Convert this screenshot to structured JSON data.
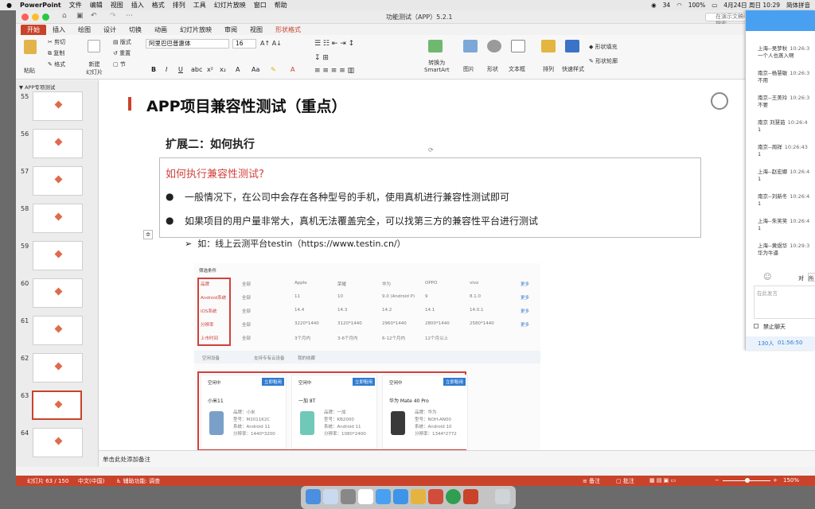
{
  "menubar": {
    "app": "PowerPoint",
    "items": [
      "文件",
      "编辑",
      "视图",
      "插入",
      "格式",
      "排列",
      "工具",
      "幻灯片放映",
      "窗口",
      "帮助"
    ],
    "battery": "100%",
    "date": "4月24日 周日 10:29",
    "ime": "简体拼音",
    "net": "34",
    "speed": "38.4 K/s\n5.6 K/s"
  },
  "window": {
    "title": "功能测试（APP）5.2.1",
    "search_placeholder": "在演示文稿中搜索"
  },
  "tabs": [
    "开始",
    "插入",
    "绘图",
    "设计",
    "切换",
    "动画",
    "幻灯片放映",
    "审阅",
    "视图",
    "形状格式"
  ],
  "ribbon": {
    "paste": "粘贴",
    "cut": "剪切",
    "copy": "复制",
    "format": "格式",
    "new_slide": "新建\n幻灯片",
    "layout": "版式",
    "reset": "重置",
    "section": "节",
    "font": "阿里巴巴普惠体",
    "size": "16",
    "convert": "转换为\nSmartArt",
    "picture": "图片",
    "shape": "形状",
    "textbox": "文本框",
    "arrange": "排列",
    "quick_styles": "快速样式",
    "shape_fill": "形状填充",
    "shape_outline": "形状轮廓"
  },
  "panel": {
    "header": "APP专项测试",
    "slides": [
      "55",
      "56",
      "57",
      "58",
      "59",
      "60",
      "61",
      "62",
      "63",
      "64"
    ],
    "selected": "63"
  },
  "slide": {
    "title": "APP项目兼容性测试（重点）",
    "subtitle": "扩展二：如何执行",
    "question": "如何执行兼容性测试?",
    "bullet1": "一般情况下，在公司中会存在各种型号的手机，使用真机进行兼容性测试即可",
    "bullet2": "如果项目的用户量非常大，真机无法覆盖完全，可以找第三方的兼容性平台进行测试",
    "sub_bullet": "如：线上云测平台testin（https://www.testin.cn/）"
  },
  "screenshot": {
    "filter_title": "筛选条件",
    "rows": [
      {
        "label": "品牌",
        "cells": [
          "全部",
          "Apple",
          "荣耀",
          "华为",
          "OPPO",
          "vivo"
        ]
      },
      {
        "label": "Android系统",
        "cells": [
          "全部",
          "11",
          "10",
          "9.0 (Android P)",
          "9",
          "8.1.0"
        ]
      },
      {
        "label": "iOS系统",
        "cells": [
          "全部",
          "14.4",
          "14.3",
          "14.2",
          "14.1",
          "14.0.1"
        ]
      },
      {
        "label": "分辨率",
        "cells": [
          "全部",
          "3220*1440",
          "3120*1440",
          "2960*1440",
          "2800*1440",
          "2580*1440"
        ]
      },
      {
        "label": "上市时间",
        "cells": [
          "全部",
          "3个月内",
          "3-6个月内",
          "6-12个月内",
          "12个月以上"
        ]
      }
    ],
    "more": "更多",
    "options": [
      "空闲设备",
      "支持专有云设备",
      "我的收藏"
    ],
    "cards": [
      {
        "status": "空闲中",
        "btn": "立即租用",
        "name": "小米11",
        "specs": [
          "品牌：小米",
          "型号：M2011K2C",
          "系统：Android 11",
          "分辨率：1440*3200"
        ]
      },
      {
        "status": "空闲中",
        "btn": "立即租用",
        "name": "一加 8T",
        "specs": [
          "品牌：一加",
          "型号：KB2000",
          "系统：Android 11",
          "分辨率：1080*2400"
        ]
      },
      {
        "status": "空闲中",
        "btn": "立即租用",
        "name": "华为 Mate 40 Pro",
        "specs": [
          "品牌：华为",
          "型号：NOH-AN00",
          "系统：Android 10",
          "分辨率：1344*2772"
        ]
      }
    ]
  },
  "notes": "单击此处添加备注",
  "status": {
    "slide": "幻灯片 63 / 150",
    "lang": "中文(中国)",
    "access": "辅助功能: 调查",
    "notes": "备注",
    "comments": "批注",
    "zoom": "150%"
  },
  "chat": {
    "messages": [
      {
        "name": "上海--吴梦秋",
        "time": "10:26:3",
        "text": "一个人也蒸入啊"
      },
      {
        "name": "南京--杨慧敏",
        "time": "10:26:3",
        "text": "不用"
      },
      {
        "name": "南京--王美玲",
        "time": "10:26:3",
        "text": "不要"
      },
      {
        "name": "南京 刘慧茹",
        "time": "10:26:4",
        "text": "1"
      },
      {
        "name": "南京--周祥",
        "time": "10:26:43",
        "text": "1"
      },
      {
        "name": "上海--赵宏娜",
        "time": "10:26:4",
        "text": "1"
      },
      {
        "name": "南京--刘新冬",
        "time": "10:26:4",
        "text": "1"
      },
      {
        "name": "上海--朱笑笑",
        "time": "10:26:4",
        "text": "1"
      },
      {
        "name": "上海--黄煜华",
        "time": "10:29:3",
        "text": "华为牛逼"
      }
    ],
    "input_placeholder": "在此发言",
    "mute": "禁止聊天",
    "online": "130人",
    "timer": "01:56:50",
    "to": "对",
    "all": "所"
  },
  "colors": {
    "accent": "#c9432b",
    "chat_header": "#49a0f0",
    "question": "#d0413c"
  }
}
